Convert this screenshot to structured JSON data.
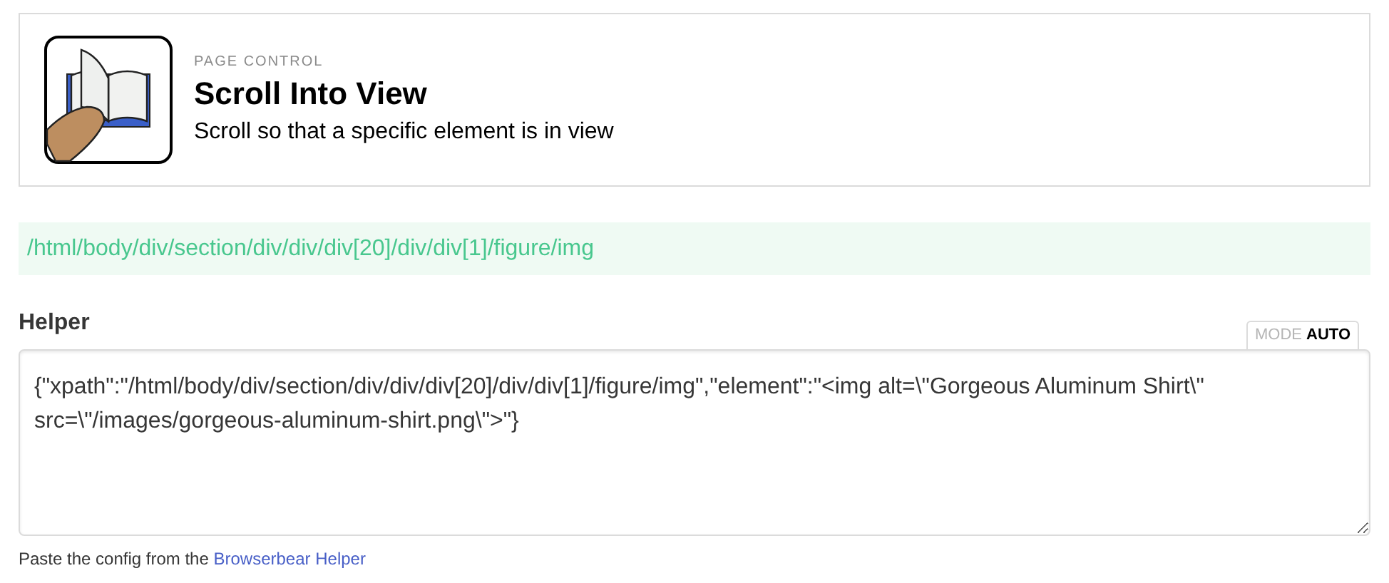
{
  "header": {
    "category": "PAGE CONTROL",
    "title": "Scroll Into View",
    "description": "Scroll so that a specific element is in view"
  },
  "xpath": "/html/body/div/section/div/div/div[20]/div/div[1]/figure/img",
  "helper": {
    "label": "Helper",
    "mode_label": "MODE",
    "mode_value": "AUTO",
    "value": "{\"xpath\":\"/html/body/div/section/div/div/div[20]/div/div[1]/figure/img\",\"element\":\"<img alt=\\\"Gorgeous Aluminum Shirt\\\" src=\\\"/images/gorgeous-aluminum-shirt.png\\\">\"}"
  },
  "hint": {
    "text": "Paste the config from the",
    "link": "Browserbear Helper"
  }
}
